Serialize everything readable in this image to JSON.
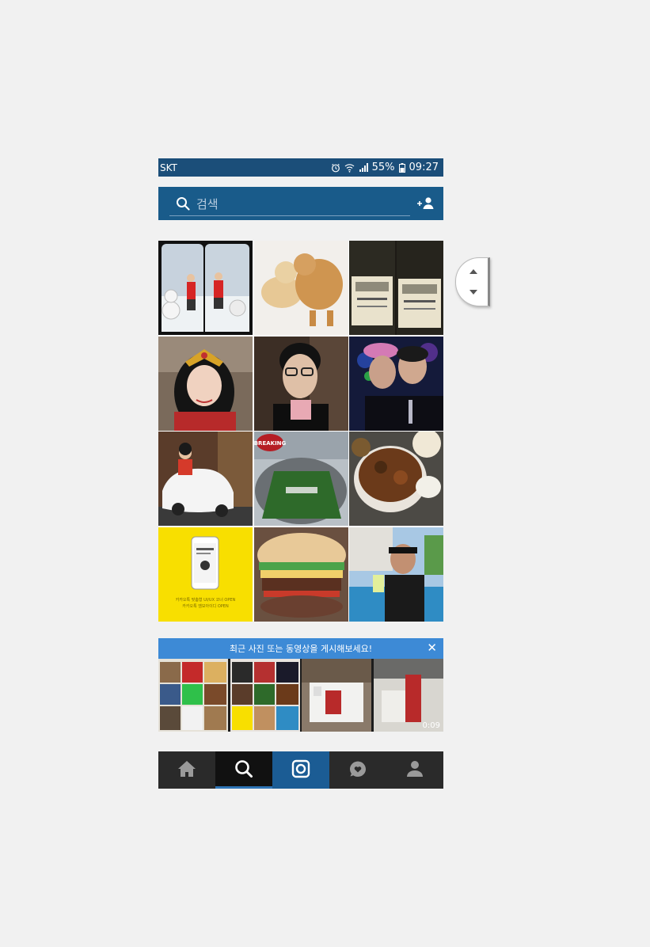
{
  "status_bar": {
    "carrier": "SKT",
    "battery": "55%",
    "time": "09:27"
  },
  "search": {
    "placeholder": "검색"
  },
  "grid": {
    "tiles": [
      "snowman-kids-photo",
      "puppies-photo",
      "wine-bottles-photo",
      "costume-woman-photo",
      "man-glasses-photo",
      "two-men-selfie-photo",
      "child-toy-car-photo",
      "stadium-photo",
      "food-bowl-photo",
      "kakaotalk-ad-photo",
      "burger-photo",
      "pool-selfie-photo"
    ],
    "stadium_badge": "BREAKING",
    "ad_text_line1": "카카오톡 맞춤형 UI/UX 코너 OPEN",
    "ad_text_line2": "카카오톡 엠모아이디 OPEN"
  },
  "upload_banner": {
    "text": "최근 사진 또는 동영상을 게시해보세요!",
    "close_icon": "close-icon"
  },
  "recent": {
    "video_duration": "0:09"
  },
  "tabbar": {
    "items": [
      "home-icon",
      "search-icon",
      "camera-icon",
      "activity-heart-icon",
      "profile-icon"
    ]
  }
}
